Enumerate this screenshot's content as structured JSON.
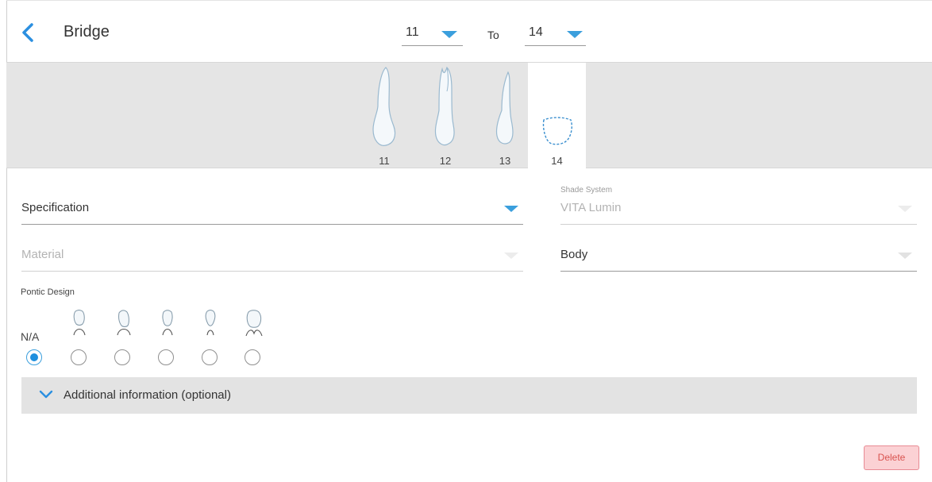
{
  "header": {
    "title": "Bridge",
    "from_value": "11",
    "to_label": "To",
    "to_value": "14"
  },
  "teeth": [
    {
      "number": "11",
      "icon": "tooth-11-icon"
    },
    {
      "number": "12",
      "icon": "tooth-12-icon"
    },
    {
      "number": "13",
      "icon": "tooth-13-icon"
    },
    {
      "number": "14",
      "icon": "missing-tooth-outline-icon"
    }
  ],
  "form": {
    "specification": "Specification",
    "material": "Material",
    "shade_system_label": "Shade System",
    "shade_system_value": "VITA Lumin",
    "body": "Body",
    "pontic_design_label": "Pontic Design",
    "na_label": "N/A",
    "pontic_selected": "N/A"
  },
  "additional": {
    "label": "Additional information (optional)"
  },
  "actions": {
    "delete_label": "Delete"
  },
  "colors": {
    "accent": "#3b9fdd",
    "delete_bg": "#fbd1d4",
    "delete_text": "#d9534f",
    "strip_bg": "#e5e5e5"
  }
}
